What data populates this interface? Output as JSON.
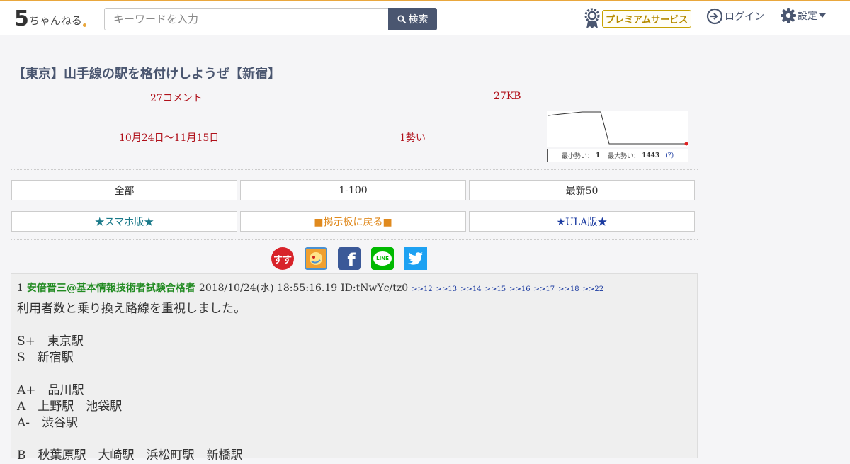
{
  "header": {
    "logo": {
      "five": "5",
      "name": "ちゃんねる"
    },
    "search": {
      "placeholder": "キーワードを入力",
      "button": "検索"
    },
    "premium_label": "プレミアムサービス",
    "login_label": "ログイン",
    "settings_label": "設定"
  },
  "thread": {
    "title": "【東京】山手線の駅を格付けしようぜ【新宿】",
    "comments": "27コメント",
    "size": "27KB",
    "period": "10月24日〜11月15日",
    "momentum": "1勢い",
    "graph_caption": {
      "min_label": "最小勢い：",
      "min_value": "1",
      "max_label": "最大勢い：",
      "max_value": "1443",
      "help": "(?)"
    }
  },
  "nav": {
    "row1": [
      "全部",
      "1-100",
      "最新50"
    ],
    "row2": [
      "★スマホ版★",
      "■掲示板に戻る■",
      "★ULA版★"
    ]
  },
  "colors": {
    "accent": "#4a5670",
    "link_teal": "#1a7a8a",
    "link_orange": "#e08a1e",
    "link_blue": "#1a3aa0",
    "author_green": "#228b22",
    "meta_red": "#b0101a"
  },
  "social": [
    {
      "name": "sukusuku-icon",
      "label": "すす"
    },
    {
      "name": "bookmark-icon",
      "label": ""
    },
    {
      "name": "facebook-icon",
      "label": "f"
    },
    {
      "name": "line-icon",
      "label": "LINE"
    },
    {
      "name": "twitter-icon",
      "label": ""
    }
  ],
  "post": {
    "number": "1",
    "author": "安倍晋三@基本情報技術者試験合格者",
    "date": "2018/10/24(水) 18:55:16.19",
    "id": "ID:tNwYc/tz0",
    "anchors": [
      ">>12",
      ">>13",
      ">>14",
      ">>15",
      ">>16",
      ">>17",
      ">>18",
      ">>22"
    ],
    "lines": [
      "利用者数と乗り換え路線を重視しました。",
      "",
      "S+　東京駅",
      "S　新宿駅",
      "",
      "A+　品川駅",
      "A　上野駅　池袋駅",
      "A-　渋谷駅",
      "",
      "B　秋葉原駅　大崎駅　浜松町駅　新橋駅"
    ]
  }
}
